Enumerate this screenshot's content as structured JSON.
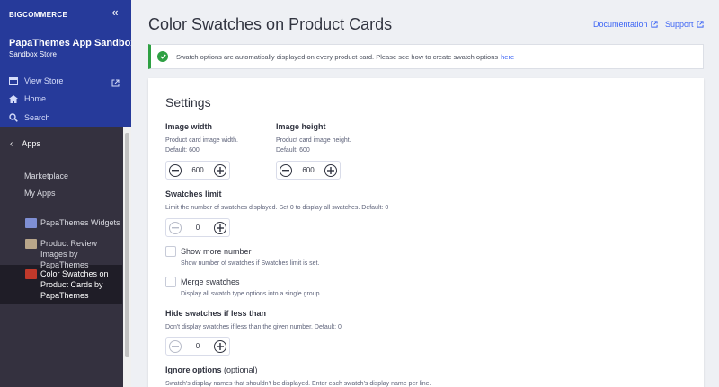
{
  "sidebar": {
    "brand": "BIGCOMMERCE",
    "store_name": "PapaThemes App Sandbox",
    "store_type": "Sandbox Store",
    "nav": [
      {
        "label": "View Store",
        "icon": "store-icon"
      },
      {
        "label": "Home",
        "icon": "home-icon"
      },
      {
        "label": "Search",
        "icon": "search-icon"
      }
    ],
    "apps_label": "Apps",
    "marketplace": "Marketplace",
    "my_apps": "My Apps",
    "apps": [
      {
        "label": "PapaThemes Widgets",
        "color": "#7f8fd4"
      },
      {
        "label": "Product Review Images by PapaThemes",
        "color": "#b9a68a"
      },
      {
        "label": "Color Swatches on Product Cards by PapaThemes",
        "color": "#c0392b",
        "active": true
      }
    ]
  },
  "header": {
    "title": "Color Swatches on Product Cards",
    "documentation": "Documentation",
    "support": "Support"
  },
  "alert": {
    "text": "Swatch options are automatically displayed on every product card. Please see how to create swatch options",
    "link": "here"
  },
  "settings": {
    "title": "Settings",
    "image_width": {
      "label": "Image width",
      "help1": "Product card image width.",
      "help2": "Default: 600",
      "value": "600"
    },
    "image_height": {
      "label": "Image height",
      "help1": "Product card image height.",
      "help2": "Default: 600",
      "value": "600"
    },
    "swatches_limit": {
      "label": "Swatches limit",
      "help": "Limit the number of swatches displayed. Set 0 to display all swatches. Default: 0",
      "value": "0"
    },
    "show_more": {
      "label": "Show more number",
      "help": "Show number of swatches if Swatches limit is set."
    },
    "merge": {
      "label": "Merge swatches",
      "help": "Display all swatch type options into a single group."
    },
    "hide_less": {
      "label": "Hide swatches if less than",
      "help": "Don't display swatches if less than the given number. Default: 0",
      "value": "0"
    },
    "ignore": {
      "label": "Ignore options",
      "optional": "(optional)",
      "help": "Swatch's display names that shouldn't be displayed. Enter each swatch's display name per line."
    }
  },
  "colors": {
    "accent": "#3c64f4",
    "sidebar_top": "#263a9a",
    "sidebar": "#34313f",
    "success": "#2ea043"
  }
}
